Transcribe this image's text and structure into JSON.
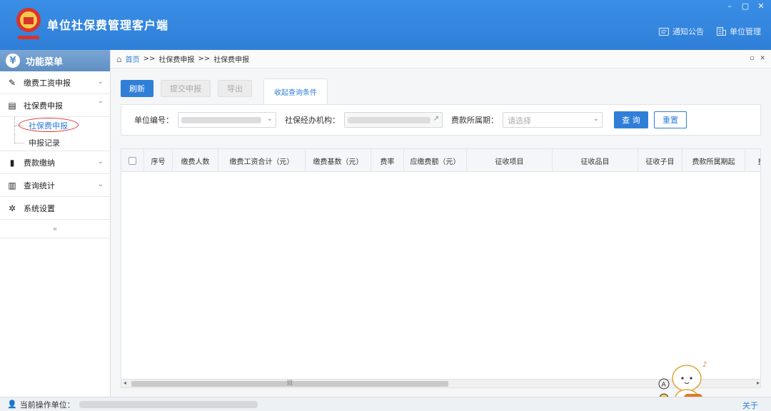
{
  "header": {
    "app_title": "单位社保费管理客户端",
    "links": [
      "通知公告",
      "单位管理"
    ],
    "window_controls": [
      "–",
      "▢",
      "✕"
    ]
  },
  "sidebar": {
    "title": "功能菜单",
    "collapse_glyph": "«",
    "items": [
      {
        "label": "缴费工资申报",
        "icon": "edit-icon",
        "expanded": false
      },
      {
        "label": "社保费申报",
        "icon": "document-icon",
        "expanded": true,
        "children": [
          {
            "label": "社保费申报",
            "active": true
          },
          {
            "label": "申报记录",
            "active": false
          }
        ]
      },
      {
        "label": "费款缴纳",
        "icon": "book-icon",
        "expanded": false
      },
      {
        "label": "查询统计",
        "icon": "chart-icon",
        "expanded": false
      },
      {
        "label": "系统设置",
        "icon": "gear-icon",
        "expanded": false
      }
    ]
  },
  "breadcrumb": {
    "home": "首页",
    "separator": ">>",
    "path": [
      "社保费申报",
      "社保费申报"
    ]
  },
  "toolbar": {
    "refresh": "刷新",
    "submit": "提交申报",
    "export": "导出",
    "collapse_query": "收起查询条件"
  },
  "query": {
    "unit_code_label": "单位编号：",
    "agency_label": "社保经办机构：",
    "period_label": "费款所属期：",
    "period_placeholder": "请选择",
    "query_button": "查 询",
    "reset_button": "重置"
  },
  "table": {
    "columns": [
      "序号",
      "缴费人数",
      "缴费工资合计（元）",
      "缴费基数（元）",
      "费率",
      "应缴费额（元）",
      "征收项目",
      "征收品目",
      "征收子目",
      "费款所属期起",
      "费"
    ],
    "rows": [],
    "scroll_grip": "|||"
  },
  "statusbar": {
    "current_unit_label": "当前操作单位：",
    "about": "关于"
  },
  "colors": {
    "header_blue": "#2f7fd8",
    "primary": "#2f7fd8",
    "sidebar_head": "#6b98c9",
    "active_circle": "#dd3333"
  }
}
